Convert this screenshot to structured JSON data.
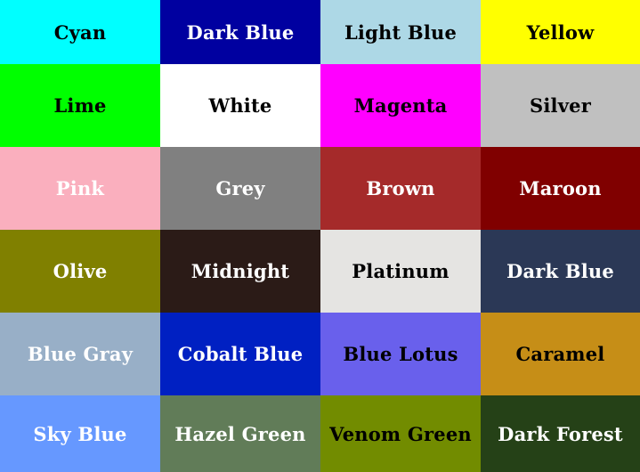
{
  "swatches": [
    {
      "label": "Cyan",
      "bg": "#00FFFF",
      "fg": "#000000"
    },
    {
      "label": "Dark Blue",
      "bg": "#0000A0",
      "fg": "#FFFFFF"
    },
    {
      "label": "Light Blue",
      "bg": "#ADD8E6",
      "fg": "#000000"
    },
    {
      "label": "Yellow",
      "bg": "#FFFF00",
      "fg": "#000000"
    },
    {
      "label": "Lime",
      "bg": "#00FF00",
      "fg": "#000000"
    },
    {
      "label": "White",
      "bg": "#FFFFFF",
      "fg": "#000000"
    },
    {
      "label": "Magenta",
      "bg": "#FF00FF",
      "fg": "#000000"
    },
    {
      "label": "Silver",
      "bg": "#C0C0C0",
      "fg": "#000000"
    },
    {
      "label": "Pink",
      "bg": "#FAAFBE",
      "fg": "#FFFFFF"
    },
    {
      "label": "Grey",
      "bg": "#808080",
      "fg": "#FFFFFF"
    },
    {
      "label": "Brown",
      "bg": "#A52A2A",
      "fg": "#FFFFFF"
    },
    {
      "label": "Maroon",
      "bg": "#800000",
      "fg": "#FFFFFF"
    },
    {
      "label": "Olive",
      "bg": "#808000",
      "fg": "#FFFFFF"
    },
    {
      "label": "Midnight",
      "bg": "#2B1B17",
      "fg": "#FFFFFF"
    },
    {
      "label": "Platinum",
      "bg": "#E5E4E2",
      "fg": "#000000"
    },
    {
      "label": "Dark Blue",
      "bg": "#2B3856",
      "fg": "#FFFFFF"
    },
    {
      "label": "Blue Gray",
      "bg": "#98AFC7",
      "fg": "#FFFFFF"
    },
    {
      "label": "Cobalt Blue",
      "bg": "#0020C2",
      "fg": "#FFFFFF"
    },
    {
      "label": "Blue Lotus",
      "bg": "#6960EC",
      "fg": "#000000"
    },
    {
      "label": "Caramel",
      "bg": "#C68E17",
      "fg": "#000000"
    },
    {
      "label": "Sky Blue",
      "bg": "#6698FF",
      "fg": "#FFFFFF"
    },
    {
      "label": "Hazel Green",
      "bg": "#617C58",
      "fg": "#FFFFFF"
    },
    {
      "label": "Venom Green",
      "bg": "#728C00",
      "fg": "#000000"
    },
    {
      "label": "Dark Forest",
      "bg": "#254117",
      "fg": "#FFFFFF"
    }
  ]
}
